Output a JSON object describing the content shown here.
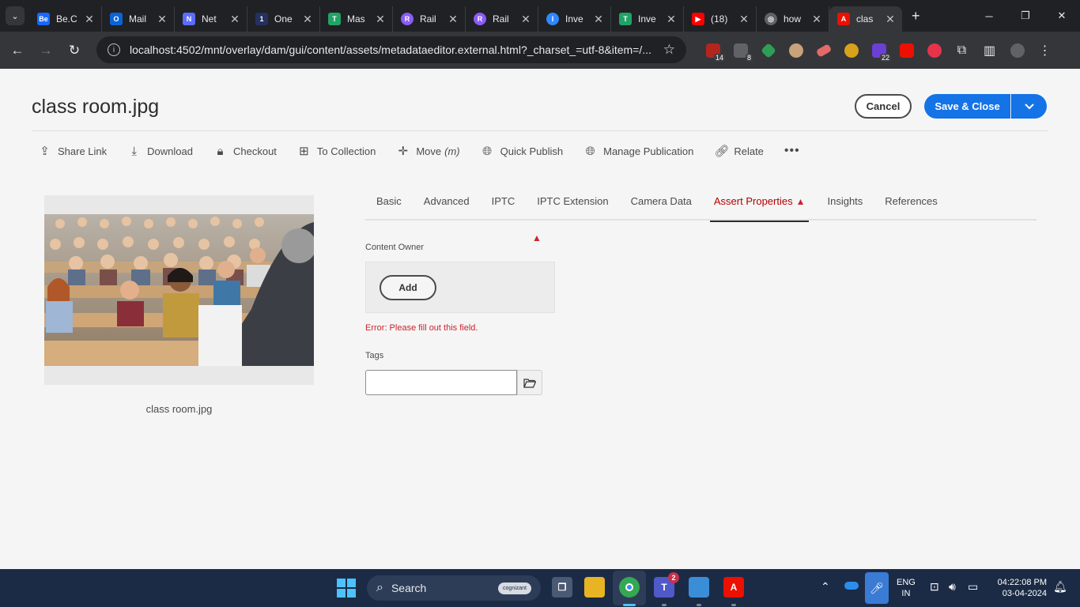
{
  "browser": {
    "tabs": [
      {
        "title": "Be.C",
        "color": "#1769ff",
        "glyph": "Be"
      },
      {
        "title": "Mail",
        "color": "#0a64d6",
        "glyph": "O"
      },
      {
        "title": "Net",
        "color": "#5b6cff",
        "glyph": "N"
      },
      {
        "title": "One",
        "color": "#24305e",
        "glyph": "1"
      },
      {
        "title": "Mas",
        "color": "#21a366",
        "glyph": "T"
      },
      {
        "title": "Rail",
        "color": "#8b5cf6",
        "glyph": "R"
      },
      {
        "title": "Rail",
        "color": "#8b5cf6",
        "glyph": "R"
      },
      {
        "title": "Inve",
        "color": "#2f88ff",
        "glyph": "I"
      },
      {
        "title": "Inve",
        "color": "#21a366",
        "glyph": "T"
      },
      {
        "title": "(18)",
        "color": "#ff0000",
        "glyph": "▶"
      },
      {
        "title": "how",
        "color": "#5f6368",
        "glyph": "◎"
      },
      {
        "title": "clas",
        "color": "#eb1000",
        "glyph": "A"
      }
    ],
    "url": "localhost:4502/mnt/overlay/dam/gui/content/assets/metadataeditor.external.html?_charset_=utf-8&item=/...",
    "ext_badges": {
      "a": "14",
      "b": "8",
      "c": "22"
    }
  },
  "page": {
    "title": "class room.jpg",
    "cancel_label": "Cancel",
    "save_label": "Save & Close",
    "actions": {
      "share": "Share Link",
      "download": "Download",
      "checkout": "Checkout",
      "collection": "To Collection",
      "move": "Move",
      "move_shortcut": "(m)",
      "quick_publish": "Quick Publish",
      "manage_publication": "Manage Publication",
      "relate": "Relate"
    },
    "asset_name": "class room.jpg",
    "tabs": {
      "basic": "Basic",
      "advanced": "Advanced",
      "iptc": "IPTC",
      "iptc_ext": "IPTC Extension",
      "camera": "Camera Data",
      "assert": "Assert Properties",
      "insights": "Insights",
      "references": "References"
    },
    "form": {
      "content_owner_label": "Content Owner",
      "add_label": "Add",
      "error": "Error: Please fill out this field.",
      "tags_label": "Tags",
      "tags_value": ""
    }
  },
  "taskbar": {
    "search_label": "Search",
    "search_pill": "cognizant",
    "teams_badge": "2",
    "lang_top": "ENG",
    "lang_bottom": "IN",
    "time": "04:22:08 PM",
    "date": "03-04-2024"
  },
  "colors": {
    "accent": "#1473e6",
    "error": "#c9252d"
  }
}
